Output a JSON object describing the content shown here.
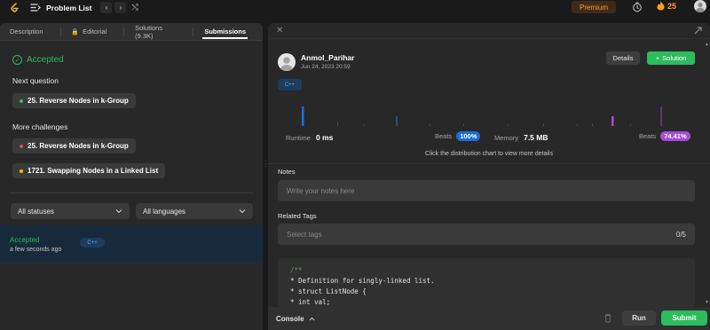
{
  "topbar": {
    "title": "Problem List",
    "prev_label": "‹",
    "next_label": "›",
    "shuffle_label": "⤭",
    "premium_label": "Premium",
    "streak_count": "25",
    "accent": "#ffa116"
  },
  "tabs": [
    {
      "label": "Description"
    },
    {
      "label": "Editorial"
    },
    {
      "label": "Solutions (9.3K)"
    },
    {
      "label": "Submissions"
    }
  ],
  "left": {
    "status": "Accepted",
    "next_question_label": "Next question",
    "next_question": "25. Reverse Nodes in k-Group",
    "more_challenges_label": "More challenges",
    "challenges": [
      {
        "title": "25. Reverse Nodes in k-Group",
        "dot_color": "#ef4743"
      },
      {
        "title": "1721. Swapping Nodes in a Linked List",
        "dot_color": "#ffb800"
      }
    ],
    "status_filter": "All statuses",
    "language_filter": "All languages",
    "submission": {
      "status": "Accepted",
      "time": "a few seconds ago",
      "language": "C++"
    }
  },
  "right": {
    "user_name": "Anmol_Parihar",
    "date": "Jun 24, 2023 20:59",
    "details_label": "Details",
    "solution_label": "Solution",
    "language": "C++",
    "runtime_label": "Runtime",
    "runtime_value": "0 ms",
    "beats_label": "Beats",
    "runtime_beats": "100%",
    "memory_label": "Memory",
    "memory_value": "7.5 MB",
    "memory_beats": "74.41%",
    "chart_hint": "Click the distribution chart to view more details",
    "notes_label": "Notes",
    "notes_placeholder": "Write your notes here",
    "tags_label": "Related Tags",
    "tags_placeholder": "Select tags",
    "tags_count": "0/5",
    "code_lines": [
      "/**",
      " * Definition for singly-linked list.",
      " * struct ListNode {",
      " *     int val;"
    ],
    "console_label": "Console",
    "run_label": "Run",
    "submit_label": "Submit"
  },
  "colors": {
    "green": "#2cbb5d",
    "blue": "#1b6fd6",
    "purple": "#a64ad9"
  }
}
